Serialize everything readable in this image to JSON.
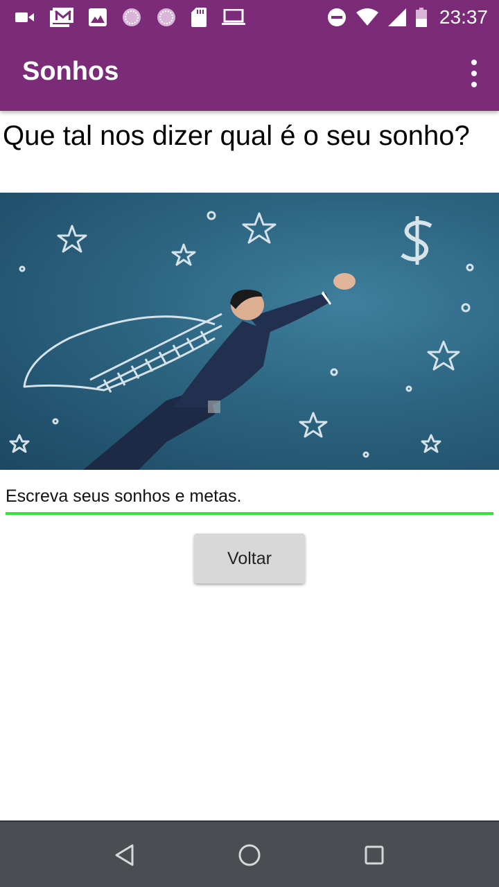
{
  "status_bar": {
    "time": "23:37",
    "left_icons": [
      "video-camera-icon",
      "gmail-icon",
      "gallery-icon",
      "sync-icon",
      "sync-icon",
      "sd-card-icon",
      "laptop-icon"
    ],
    "right_icons": [
      "do-not-disturb-icon",
      "wifi-icon",
      "signal-icon",
      "battery-icon"
    ]
  },
  "app_bar": {
    "title": "Sonhos",
    "menu_icon": "more-vert-icon",
    "color": "#7b2b78"
  },
  "content": {
    "question": "Que tal nos dizer qual é o seu sonho?",
    "image_icon": "flying-businessman-chalkboard-image",
    "dream_input": {
      "value": "Escreva seus sonhos e metas.",
      "underline_color": "#2ee82e"
    },
    "back_button_label": "Voltar"
  },
  "nav_bar": {
    "buttons": [
      "back-triangle-icon",
      "home-circle-icon",
      "recents-square-icon"
    ]
  }
}
